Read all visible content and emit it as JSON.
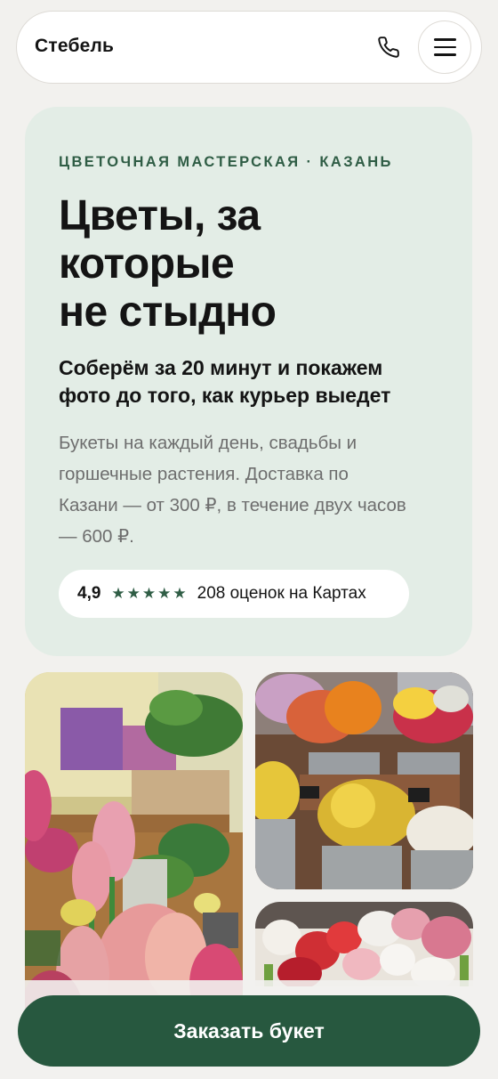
{
  "header": {
    "brand": "Стебель",
    "phone_icon": "phone-icon",
    "menu_icon": "hamburger-menu-icon"
  },
  "hero": {
    "eyebrow": "ЦВЕТОЧНАЯ МАСТЕРСКАЯ · КАЗАНЬ",
    "title_lines": [
      "Цветы, за",
      "которые",
      "не стыдно"
    ],
    "subtitle_lines": [
      "Соберём за 20 минут и покажем",
      "фото до того, как курьер выедет"
    ],
    "description_lines": [
      "Букеты на каждый день, свадьбы и",
      "горшечные растения. Доставка по",
      "Казани — от 300 ₽, в течение двух часов",
      "— 600 ₽."
    ],
    "rating": {
      "value": "4,9",
      "stars": "★★★★★",
      "star_count": 5,
      "label": "208 оценок на Картах"
    }
  },
  "photos": [
    {
      "subject": "hyacinths-in-pots"
    },
    {
      "subject": "flower-buckets-market"
    },
    {
      "subject": "tulips-bunch"
    }
  ],
  "cta": {
    "label": "Заказать букет"
  },
  "colors": {
    "accent": "#27583f",
    "eyebrow": "#2f5d45",
    "hero_bg": "#e3ede6",
    "page_bg": "#f2f1ee"
  }
}
